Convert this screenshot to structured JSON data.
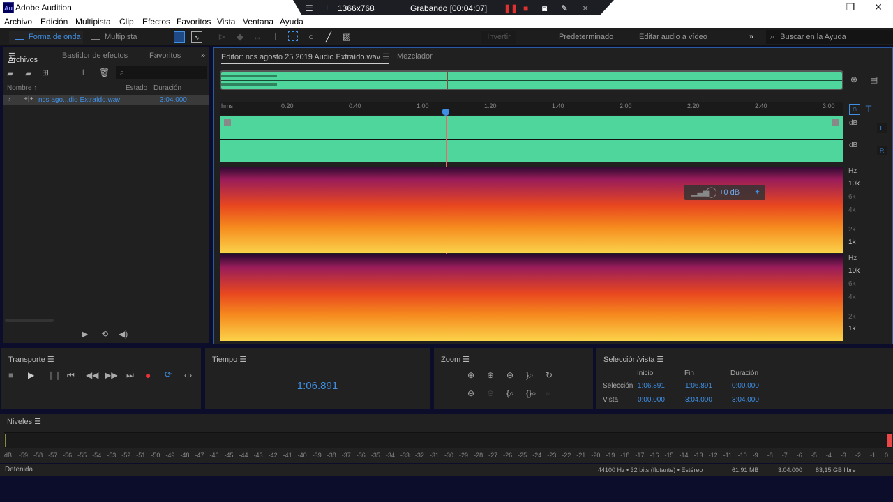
{
  "window": {
    "app_logo": "Au",
    "title": "Adobe Audition",
    "minimize": "—",
    "restore": "❐",
    "close": "✕"
  },
  "recorder": {
    "menu_icon": "☰",
    "pin_icon": "📌",
    "resolution": "1366x768",
    "status": "Grabando [00:04:07]",
    "pause_icon": "❚❚",
    "stop_icon": "■",
    "camera_icon": "📷",
    "pen_icon": "✎",
    "close_icon": "✕"
  },
  "menu": [
    "Archivo",
    "Edición",
    "Multipista",
    "Clip",
    "Efectos",
    "Favoritos",
    "Vista",
    "Ventana",
    "Ayuda"
  ],
  "toolbar": {
    "waveform_label": "Forma de onda",
    "multitrack_label": "Multipista",
    "invert_label": "Invertir",
    "workspace_default": "Predeterminado",
    "workspace_edit_video": "Editar audio a vídeo",
    "more": "»",
    "search_placeholder": "Buscar en la Ayuda"
  },
  "files_panel": {
    "tabs": [
      "Archivos",
      "Bastidor de efectos",
      "Favoritos"
    ],
    "columns": {
      "name": "Nombre",
      "status": "Estado",
      "duration": "Duración"
    },
    "files": [
      {
        "name": "ncs ago...dio Extraído.wav",
        "status": "",
        "duration": "3:04.000"
      }
    ]
  },
  "editor": {
    "tab_label": "Editor: ncs agosto 25 2019 Audio Extraído.wav",
    "mixer_label": "Mezclador",
    "ruler_unit": "hms",
    "ruler_ticks": [
      "0:20",
      "0:40",
      "1:00",
      "1:20",
      "1:40",
      "2:00",
      "2:20",
      "2:40",
      "3:00"
    ],
    "playhead_time": "1:06.891",
    "channels": [
      {
        "label": "L",
        "unit": "dB"
      },
      {
        "label": "R",
        "unit": "dB"
      }
    ],
    "spectral_unit": "Hz",
    "spectral_ticks": [
      "10k",
      "6k",
      "4k",
      "2k",
      "1k"
    ],
    "hud_gain": "+0 dB",
    "waveform_color": "#4fd69c",
    "accent": "#3f8fe4"
  },
  "transport": {
    "title": "Transporte"
  },
  "time": {
    "title": "Tiempo",
    "value": "1:06.891"
  },
  "zoom": {
    "title": "Zoom"
  },
  "selection": {
    "title": "Selección/vista",
    "headers": [
      "Inicio",
      "Fin",
      "Duración"
    ],
    "rows": [
      {
        "label": "Selección",
        "start": "1:06.891",
        "end": "1:06.891",
        "duration": "0:00.000"
      },
      {
        "label": "Vista",
        "start": "0:00.000",
        "end": "3:04.000",
        "duration": "3:04.000"
      }
    ]
  },
  "levels": {
    "title": "Niveles",
    "scale": [
      "dB",
      "-59",
      "-58",
      "-57",
      "-56",
      "-55",
      "-54",
      "-53",
      "-52",
      "-51",
      "-50",
      "-49",
      "-48",
      "-47",
      "-46",
      "-45",
      "-44",
      "-43",
      "-42",
      "-41",
      "-40",
      "-39",
      "-38",
      "-37",
      "-36",
      "-35",
      "-34",
      "-33",
      "-32",
      "-31",
      "-30",
      "-29",
      "-28",
      "-27",
      "-26",
      "-25",
      "-24",
      "-23",
      "-22",
      "-21",
      "-20",
      "-19",
      "-18",
      "-17",
      "-16",
      "-15",
      "-14",
      "-13",
      "-12",
      "-11",
      "-10",
      "-9",
      "-8",
      "-7",
      "-6",
      "-5",
      "-4",
      "-3",
      "-2",
      "-1",
      "0"
    ]
  },
  "statusbar": {
    "state": "Detenida",
    "format": "44100 Hz • 32 bits (flotante) • Estéreo",
    "size": "61,91 MB",
    "duration": "3:04.000",
    "free": "83,15 GB libre"
  }
}
